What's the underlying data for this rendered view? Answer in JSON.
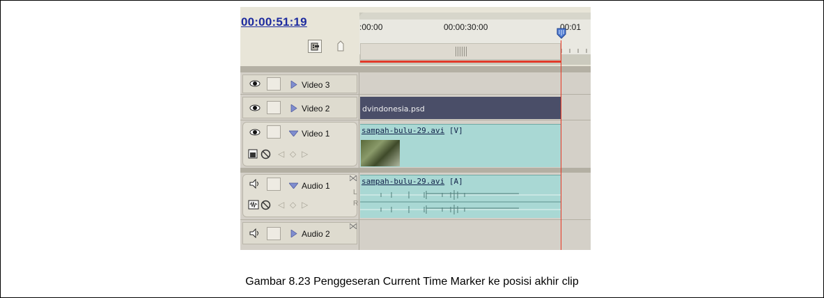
{
  "timeline": {
    "current_timecode": "00:00:51:19",
    "ruler": {
      "labels": [
        ":00:00",
        "00:00:30:00",
        "00:01"
      ]
    },
    "tracks": [
      {
        "name": "Video 3",
        "expanded": false
      },
      {
        "name": "Video 2",
        "expanded": false
      },
      {
        "name": "Video 1",
        "expanded": true
      },
      {
        "name": "Audio 1",
        "expanded": true
      },
      {
        "name": "Audio 2",
        "expanded": false
      }
    ],
    "clips": {
      "video2": "dvindonesia.psd",
      "video1_name": "sampah-bulu-29.avi",
      "video1_tag": "[V]",
      "audio1_name": "sampah-bulu-29.avi",
      "audio1_tag": "[A]"
    },
    "audio_channels": {
      "left": "L",
      "right": "R"
    }
  },
  "colors": {
    "timecode": "#1d2b9f",
    "current_time_marker": "#e8331f",
    "video_clip_dark": "#4a4e68",
    "av_clip": "#a9d8d4"
  },
  "caption": "Gambar 8.23 Penggeseran Current Time Marker ke posisi akhir clip"
}
